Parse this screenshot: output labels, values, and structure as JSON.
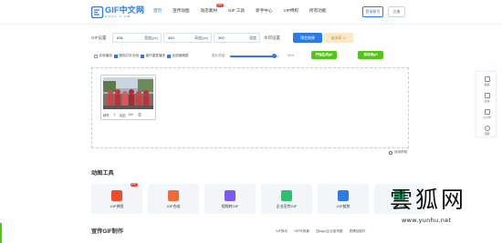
{
  "header": {
    "logo_title": "GIF中文网",
    "logo_sub": "GGUA.C OM",
    "nav": [
      "首页",
      "宣传动图",
      "动态素材",
      "GIF 工具",
      "新手中心",
      "VIP特权",
      "所有功能"
    ],
    "hot_badge": "HOT",
    "login": "登录账号",
    "register": "注册"
  },
  "settings": {
    "gif_label": "GIF设置",
    "width_value": "636",
    "width_unit": "宽度(px)",
    "height_value": "400",
    "height_unit": "高度(px)",
    "speed_value": "300",
    "speed_unit": "速度",
    "watermark_btn": "水印设置",
    "preview_btn": "预览效果",
    "vip_btn": "去水印 ☆"
  },
  "options": {
    "reverse": "反转播放",
    "remove_bg": "删除并补全帧",
    "loop": "循环重复播放",
    "full_text": "全部缩略图",
    "quality_label": "图片质量",
    "quality_value": "90%",
    "quality_fraction": 0.9,
    "gen_gif": "开始生成gif",
    "save_gif": "保存到gif"
  },
  "frame": {
    "label": "帧号",
    "index": "1",
    "delay_label": "延迟",
    "delay_value": "100"
  },
  "help": "使用帮助",
  "tools_title": "动图工具",
  "tools": [
    {
      "label": "GIF拼图",
      "color": "#f04b2d",
      "hot": "HOT"
    },
    {
      "label": "GIF合成",
      "color": "#f26a3a",
      "hot": ""
    },
    {
      "label": "视频转GIF",
      "color": "#7a5af5",
      "hot": ""
    },
    {
      "label": "企业宣传GIF",
      "color": "#2fbf71",
      "hot": ""
    },
    {
      "label": "GIF裁剪",
      "color": "#2c7be5",
      "hot": ""
    },
    {
      "label": "GIF压缩",
      "color": "#23b26d",
      "hot": ""
    }
  ],
  "promo_title": "宣传GIF制作",
  "promo_links": [
    "GIF换字",
    "GIF环背景",
    "加logo(企业宣传图",
    "表情包制作"
  ],
  "side": [
    "客服",
    "反馈",
    "公众号",
    "顶部"
  ],
  "watermark": "雲狐网",
  "watermark_url": "www.yunhu.net"
}
